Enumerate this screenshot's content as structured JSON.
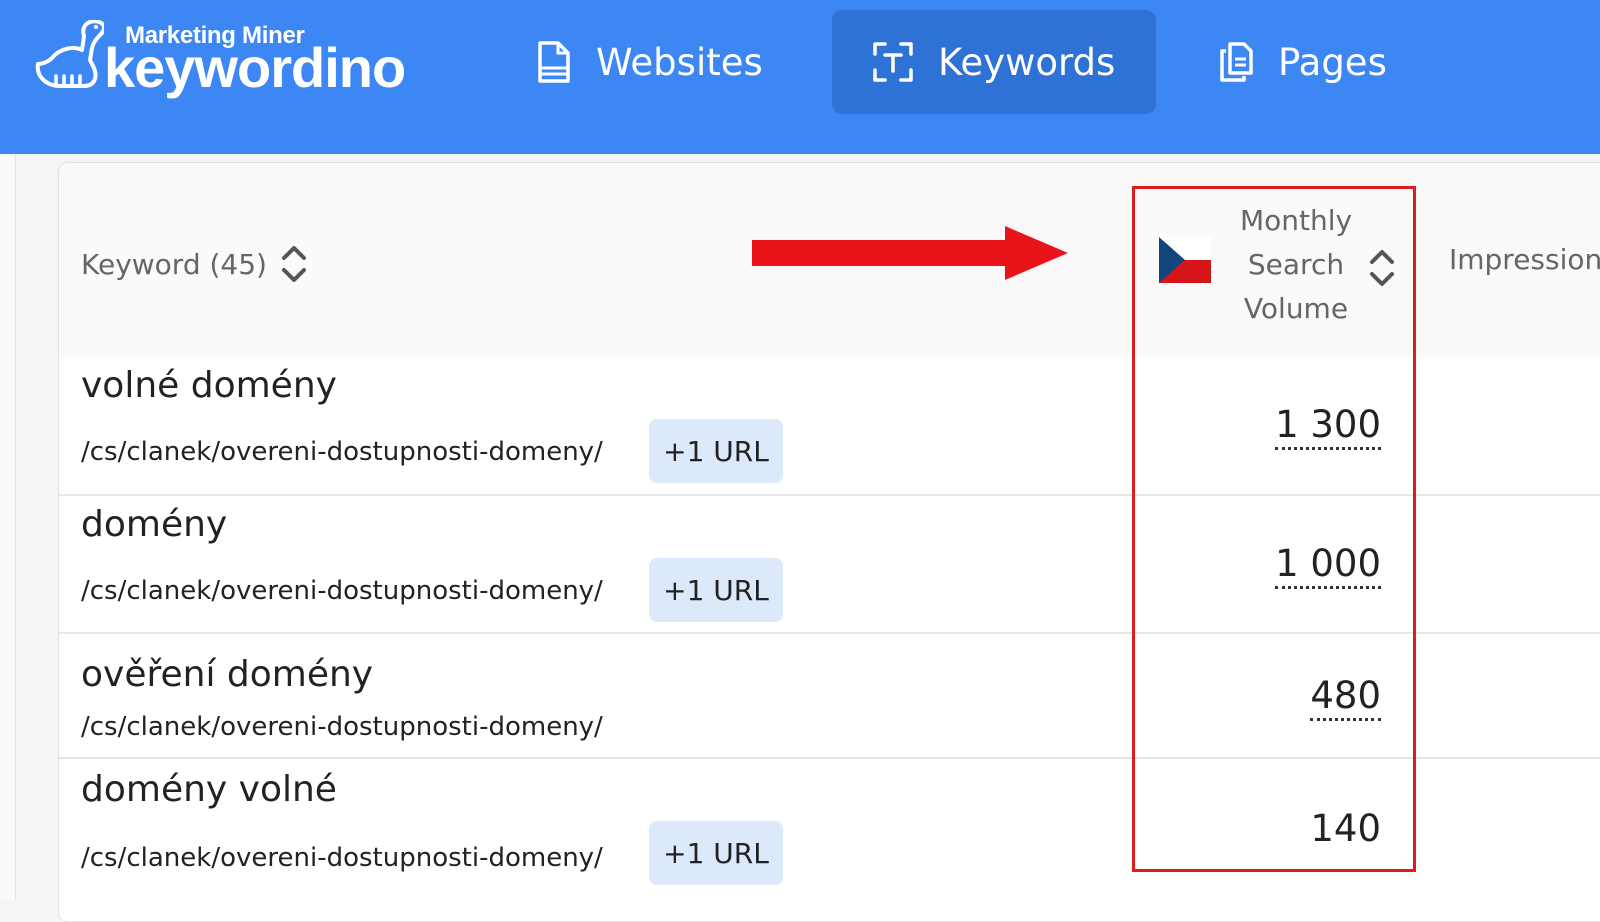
{
  "app": {
    "logo_sub": "Marketing Miner",
    "logo_main": "keywordino"
  },
  "nav": {
    "items": [
      {
        "label": "Websites",
        "icon": "document-icon",
        "active": false
      },
      {
        "label": "Keywords",
        "icon": "text-scan-icon",
        "active": true
      },
      {
        "label": "Pages",
        "icon": "pages-icon",
        "active": false
      }
    ]
  },
  "table": {
    "columns": {
      "keyword": "Keyword (45)",
      "msv": [
        "Monthly",
        "Search",
        "Volume"
      ],
      "impressions": "Impression"
    },
    "rows": [
      {
        "keyword": "volné domény",
        "url": "/cs/clanek/overeni-dostupnosti-domeny/",
        "badge": "+1 URL",
        "volume": "1 300"
      },
      {
        "keyword": "domény",
        "url": "/cs/clanek/overeni-dostupnosti-domeny/",
        "badge": "+1 URL",
        "volume": "1 000"
      },
      {
        "keyword": "ověření domény",
        "url": "/cs/clanek/overeni-dostupnosti-domeny/",
        "badge": "",
        "volume": "480"
      },
      {
        "keyword": "domény volné",
        "url": "/cs/clanek/overeni-dostupnosti-domeny/",
        "badge": "+1 URL",
        "volume": "140"
      }
    ]
  },
  "colors": {
    "topbar": "#3d87f5",
    "active_tab": "#2f72d6",
    "badge_bg": "#dce9fb",
    "highlight": "#e01b1b"
  }
}
